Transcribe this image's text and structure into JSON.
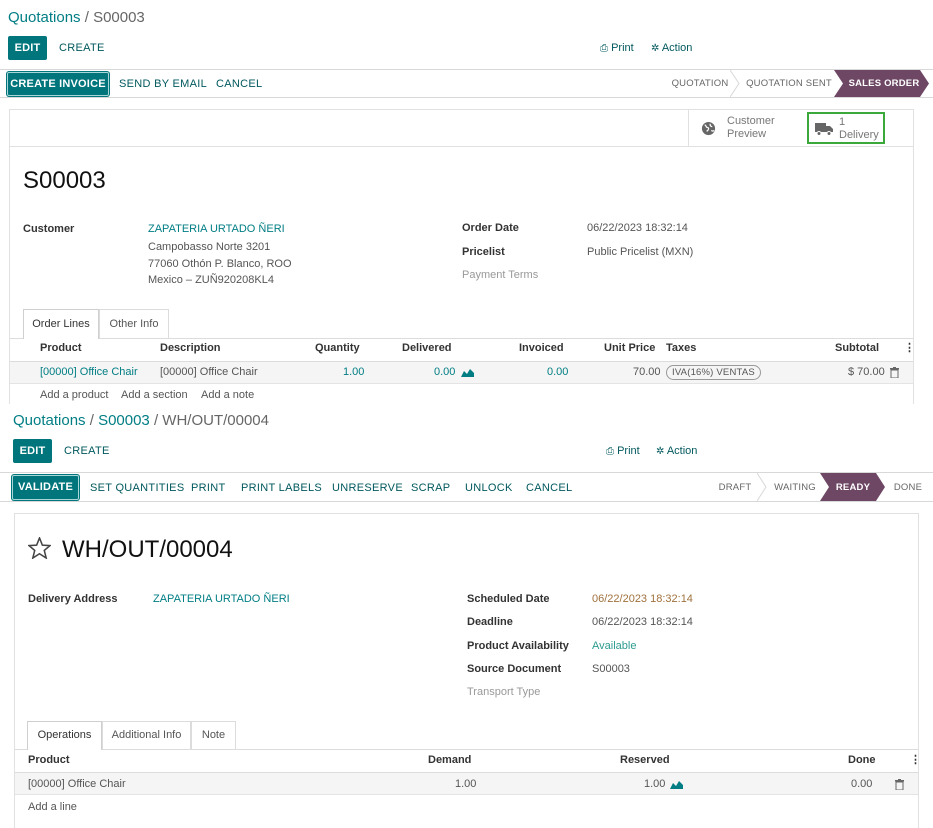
{
  "so": {
    "breadcrumb_root": "Quotations",
    "breadcrumb_sep": "/",
    "breadcrumb_current": "S00003",
    "edit_label": "EDIT",
    "create_label": "CREATE",
    "print_label": "Print",
    "action_label": "Action",
    "buttons": {
      "create_invoice": "CREATE INVOICE",
      "send_email": "SEND BY EMAIL",
      "cancel": "CANCEL"
    },
    "stages": [
      "QUOTATION",
      "QUOTATION SENT",
      "SALES ORDER"
    ],
    "active_stage": "SALES ORDER",
    "smart_buttons": {
      "customer_preview_line1": "Customer",
      "customer_preview_line2": "Preview",
      "delivery_count": "1",
      "delivery_label": "Delivery"
    },
    "title": "S00003",
    "customer_label": "Customer",
    "customer_name": "ZAPATERIA URTADO ÑERI",
    "address_line1": "Campobasso Norte 3201",
    "address_line2": "77060 Othón P. Blanco, ROO",
    "address_line3": "Mexico – ZUÑ920208KL4",
    "order_date_label": "Order Date",
    "order_date": "06/22/2023 18:32:14",
    "pricelist_label": "Pricelist",
    "pricelist": "Public Pricelist (MXN)",
    "payment_terms_label": "Payment Terms",
    "tabs": [
      "Order Lines",
      "Other Info"
    ],
    "columns": {
      "product": "Product",
      "description": "Description",
      "quantity": "Quantity",
      "delivered": "Delivered",
      "invoiced": "Invoiced",
      "unit_price": "Unit Price",
      "taxes": "Taxes",
      "subtotal": "Subtotal"
    },
    "line": {
      "product": "[00000] Office Chair",
      "description": "[00000] Office Chair",
      "quantity": "1.00",
      "delivered": "0.00",
      "invoiced": "0.00",
      "unit_price": "70.00",
      "tax": "IVA(16%) VENTAS",
      "subtotal": "$ 70.00"
    },
    "add_product": "Add a product",
    "add_section": "Add a section",
    "add_note": "Add a note"
  },
  "picking": {
    "breadcrumb_root": "Quotations",
    "breadcrumb_mid": "S00003",
    "breadcrumb_current": "WH/OUT/00004",
    "sep": "/",
    "edit_label": "EDIT",
    "create_label": "CREATE",
    "print_label": "Print",
    "action_label": "Action",
    "buttons": {
      "validate": "VALIDATE",
      "set_quantities": "SET QUANTITIES",
      "print": "PRINT",
      "print_labels": "PRINT LABELS",
      "unreserve": "UNRESERVE",
      "scrap": "SCRAP",
      "unlock": "UNLOCK",
      "cancel": "CANCEL"
    },
    "stages": [
      "DRAFT",
      "WAITING",
      "READY",
      "DONE"
    ],
    "active_stage": "READY",
    "title": "WH/OUT/00004",
    "delivery_address_label": "Delivery Address",
    "delivery_address": "ZAPATERIA URTADO ÑERI",
    "scheduled_date_label": "Scheduled Date",
    "scheduled_date": "06/22/2023 18:32:14",
    "deadline_label": "Deadline",
    "deadline": "06/22/2023 18:32:14",
    "availability_label": "Product Availability",
    "availability": "Available",
    "source_label": "Source Document",
    "source": "S00003",
    "transport_label": "Transport Type",
    "tabs": [
      "Operations",
      "Additional Info",
      "Note"
    ],
    "columns": {
      "product": "Product",
      "demand": "Demand",
      "reserved": "Reserved",
      "done": "Done"
    },
    "line": {
      "product": "[00000] Office Chair",
      "demand": "1.00",
      "reserved": "1.00",
      "done": "0.00"
    },
    "add_line": "Add a line"
  },
  "colors": {
    "primary": "#00757c",
    "active_stage": "#6e4765",
    "link": "#017e84",
    "scheduled_date": "#a0713d",
    "available": "#2e9b8f",
    "smart_highlight": "#3aa83a"
  }
}
